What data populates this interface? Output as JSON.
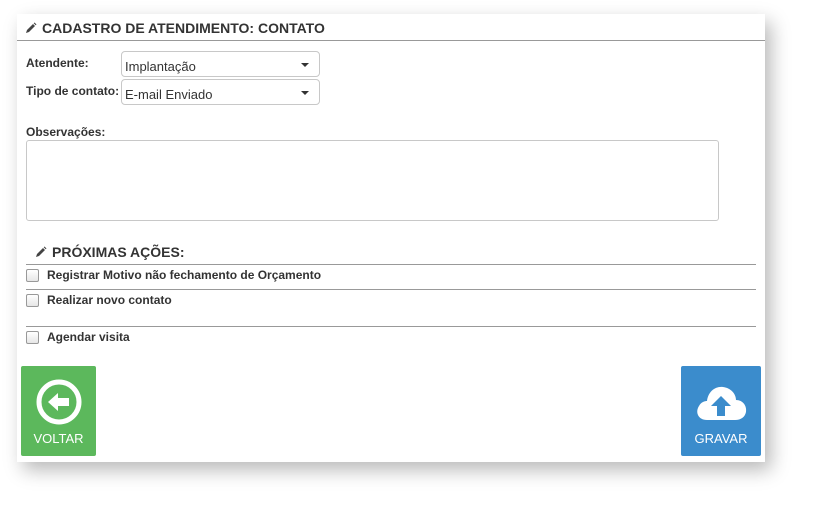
{
  "header": {
    "title": "CADASTRO DE ATENDIMENTO: CONTATO",
    "icon": "pencil-icon"
  },
  "form": {
    "atendente_label": "Atendente:",
    "atendente_value": "Implantação",
    "tipo_contato_label": "Tipo de contato:",
    "tipo_contato_value": "E-mail Enviado",
    "observacoes_label": "Observações:",
    "observacoes_value": ""
  },
  "proximas_acoes": {
    "title": "PRÓXIMAS AÇÕES:",
    "items": [
      {
        "label": "Registrar Motivo não fechamento de Orçamento",
        "checked": false
      },
      {
        "label": "Realizar novo contato",
        "checked": false
      },
      {
        "label": "Agendar visita",
        "checked": false
      }
    ]
  },
  "buttons": {
    "voltar": {
      "label": "VOLTAR",
      "icon": "arrow-left-circle-icon",
      "color": "#5cb85c"
    },
    "gravar": {
      "label": "GRAVAR",
      "icon": "cloud-upload-icon",
      "color": "#3b8ccc"
    }
  }
}
